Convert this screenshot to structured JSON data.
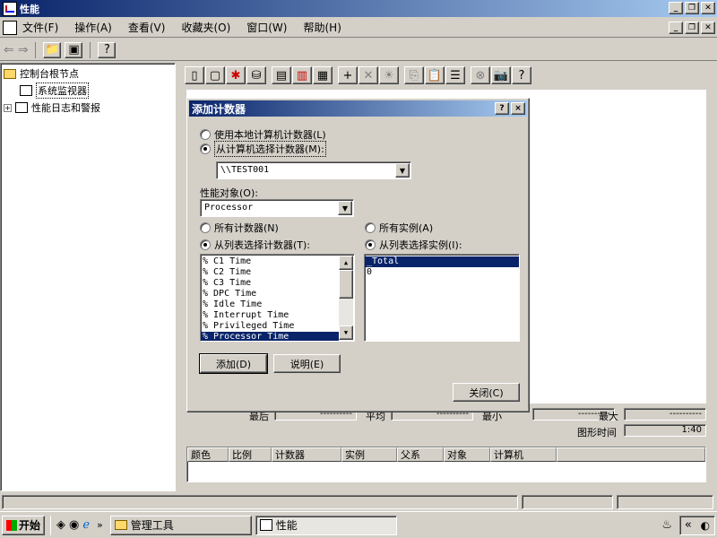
{
  "window": {
    "title": "性能"
  },
  "menu": [
    "文件(F)",
    "操作(A)",
    "查看(V)",
    "收藏夹(O)",
    "窗口(W)",
    "帮助(H)"
  ],
  "tree": {
    "root": "控制台根节点",
    "items": [
      "系统监视器",
      "性能日志和警报"
    ]
  },
  "dialog": {
    "title": "添加计数器",
    "help_btn": "?",
    "close_btn": "×",
    "radio_local": "使用本地计算机计数器(L)",
    "radio_select": "从计算机选择计数器(M):",
    "computer_value": "\\\\TEST001",
    "object_label": "性能对象(O):",
    "object_value": "Processor",
    "all_counters": "所有计数器(N)",
    "select_counters": "从列表选择计数器(T):",
    "all_instances": "所有实例(A)",
    "select_instances": "从列表选择实例(I):",
    "counters": [
      "% C1 Time",
      "% C2 Time",
      "% C3 Time",
      "% DPC Time",
      "% Idle Time",
      "% Interrupt Time",
      "% Privileged Time",
      "% Processor Time"
    ],
    "instances": [
      "_Total",
      "0"
    ],
    "add_button": "添加(D)",
    "explain_button": "说明(E)",
    "close_button": "关闭(C)"
  },
  "stats": {
    "last_label": "最后",
    "last_value": "----------",
    "avg_label": "平均",
    "avg_value": "----------",
    "min_label": "最小",
    "min_value": "----------",
    "max_label": "最大",
    "max_value": "----------",
    "duration_label": "图形时间",
    "duration_value": "1:40"
  },
  "columns": [
    "颜色",
    "比例",
    "计数器",
    "实例",
    "父系",
    "对象",
    "计算机"
  ],
  "taskbar": {
    "start": "开始",
    "tasks": [
      "管理工具",
      "性能"
    ],
    "tray_chevron": "«"
  }
}
